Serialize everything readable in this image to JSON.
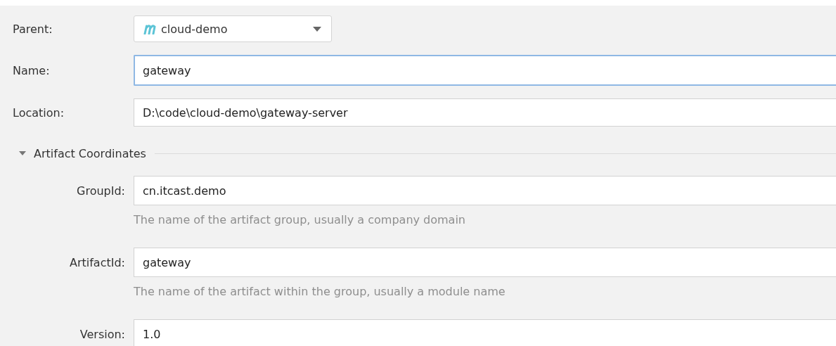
{
  "parent": {
    "label": "Parent:",
    "value": "cloud-demo"
  },
  "fields": [
    {
      "label": "Name:",
      "value": "gateway",
      "focused": true
    },
    {
      "label": "Location:",
      "value": "D:\\code\\cloud-demo\\gateway-server",
      "focused": false
    }
  ],
  "artifact_section": {
    "title": "Artifact Coordinates",
    "expanded": true,
    "fields": [
      {
        "label": "GroupId:",
        "value": "cn.itcast.demo",
        "hint": "The name of the artifact group, usually a company domain"
      },
      {
        "label": "ArtifactId:",
        "value": "gateway",
        "hint": "The name of the artifact within the group, usually a module name"
      },
      {
        "label": "Version:",
        "value": "1.0"
      }
    ]
  }
}
